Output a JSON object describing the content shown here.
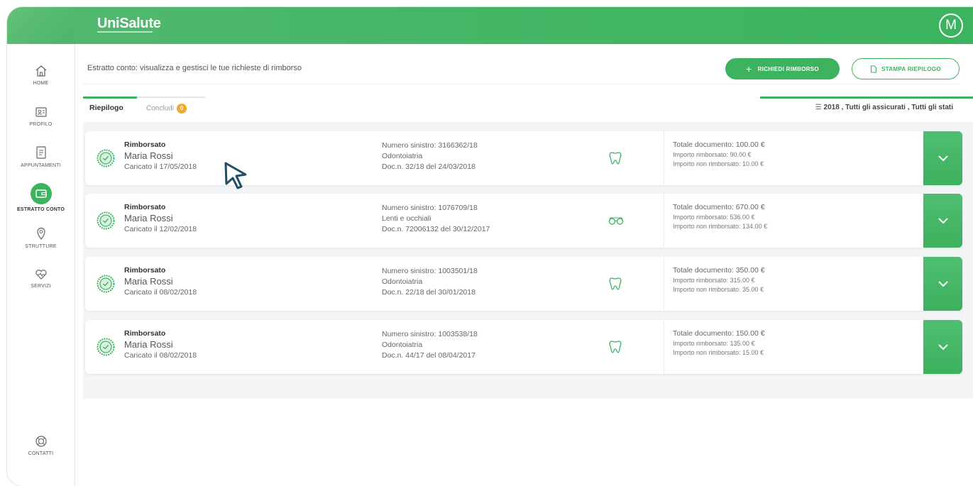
{
  "app": {
    "brand": "UniSalute",
    "avatar_initial": "M",
    "accent_color": "#3db35f"
  },
  "sidebar": {
    "items": [
      {
        "label": "HOME",
        "icon": "home-icon"
      },
      {
        "label": "PROFILO",
        "icon": "profile-card-icon"
      },
      {
        "label": "APPUNTAMENTI",
        "icon": "calendar-icon"
      },
      {
        "label": "ESTRATTO CONTO",
        "icon": "wallet-icon",
        "active": true
      },
      {
        "label": "STRUTTURE",
        "icon": "location-pin-icon"
      },
      {
        "label": "SERVIZI",
        "icon": "heart-icon"
      },
      {
        "label": "CONTATTI",
        "icon": "support-icon"
      }
    ]
  },
  "header": {
    "description": "Estratto conto: visualizza e gestisci le tue richieste di rimborso",
    "primary_button": "RICHIEDI RIMBORSO",
    "secondary_button": "STAMPA RIEPILOGO"
  },
  "tabs": {
    "riepilogo": "Riepilogo",
    "concludi": "Concludi",
    "concludi_badge": "0"
  },
  "filter": {
    "label": "2018 , Tutti gli assicurati , Tutti gli stati"
  },
  "claims": [
    {
      "status": "Rimborsato",
      "name": "Maria Rossi",
      "uploaded": "Caricato il 17/05/2018",
      "claim_number": "Numero sinistro: 3166362/18",
      "category": "Odontoiatria",
      "document": "Doc.n. 32/18 del 24/03/2018",
      "type_icon": "tooth-icon",
      "total": "Totale documento: 100.00 €",
      "reimbursed": "Importo rimborsato: 90.00 €",
      "not_reimbursed": "Importo non rimborsato: 10.00 €"
    },
    {
      "status": "Rimborsato",
      "name": "Maria Rossi",
      "uploaded": "Caricato il 12/02/2018",
      "claim_number": "Numero sinistro: 1076709/18",
      "category": "Lenti e occhiali",
      "document": "Doc.n. 72006132 del 30/12/2017",
      "type_icon": "glasses-icon",
      "total": "Totale documento: 670.00 €",
      "reimbursed": "Importo rimborsato: 536.00 €",
      "not_reimbursed": "Importo non rimborsato: 134.00 €"
    },
    {
      "status": "Rimborsato",
      "name": "Maria Rossi",
      "uploaded": "Caricato il 08/02/2018",
      "claim_number": "Numero sinistro: 1003501/18",
      "category": "Odontoiatria",
      "document": "Doc.n. 22/18 del 30/01/2018",
      "type_icon": "tooth-icon",
      "total": "Totale documento: 350.00 €",
      "reimbursed": "Importo rimborsato: 315.00 €",
      "not_reimbursed": "Importo non rimborsato: 35.00 €"
    },
    {
      "status": "Rimborsato",
      "name": "Maria Rossi",
      "uploaded": "Caricato il 08/02/2018",
      "claim_number": "Numero sinistro: 1003538/18",
      "category": "Odontoiatria",
      "document": "Doc.n. 44/17 del 08/04/2017",
      "type_icon": "tooth-icon",
      "total": "Totale documento: 150.00 €",
      "reimbursed": "Importo rimborsato: 135.00 €",
      "not_reimbursed": "Importo non rimborsato: 15.00 €"
    }
  ]
}
